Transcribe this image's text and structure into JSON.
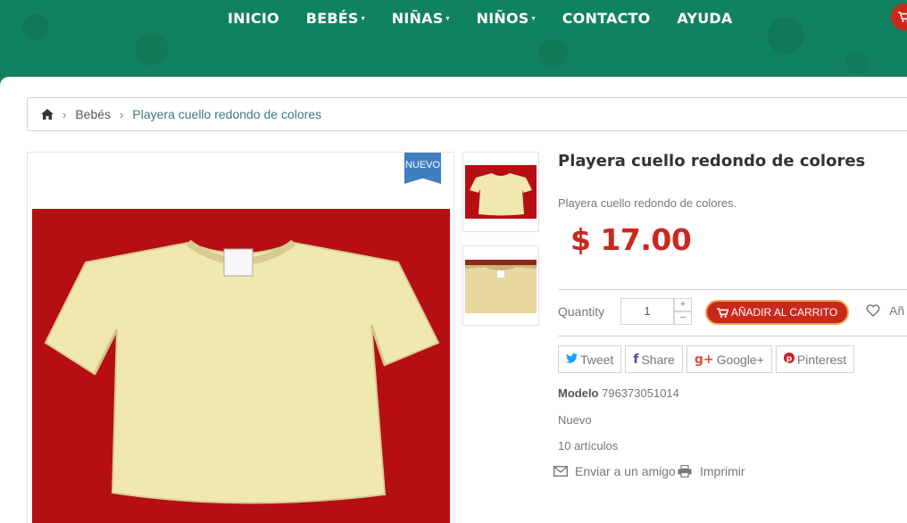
{
  "nav": {
    "items": [
      {
        "label": "INICIO",
        "has_caret": false
      },
      {
        "label": "BEBÉS",
        "has_caret": true
      },
      {
        "label": "NIÑAS",
        "has_caret": true
      },
      {
        "label": "NIÑOS",
        "has_caret": true
      },
      {
        "label": "CONTACTO",
        "has_caret": false
      },
      {
        "label": "AYUDA",
        "has_caret": false
      }
    ],
    "caret": "▾"
  },
  "breadcrumb": {
    "sep": "›",
    "category": "Bebés",
    "current": "Playera cuello redondo de colores"
  },
  "product": {
    "badge": "NUEVO",
    "title": "Playera cuello redondo de colores",
    "description": "Playera cuello redondo de colores.",
    "price": "$ 17.00",
    "quantity_label": "Quantity",
    "quantity_value": "1",
    "qty_plus": "+",
    "qty_minus": "−",
    "add_to_cart": "AÑADIR AL CARRITO",
    "wishlist_label": "Añ",
    "model_label": "Modelo",
    "model_value": "796373051014",
    "condition": "Nuevo",
    "stock": "10 artículos",
    "send_friend": "Enviar a un amigo",
    "print": "Imprimir"
  },
  "social": [
    {
      "icon": "twitter-icon",
      "glyph": "🐦",
      "label": "Tweet",
      "color": "#1da1f2"
    },
    {
      "icon": "facebook-icon",
      "glyph": "f",
      "label": "Share",
      "color": "#3b5998"
    },
    {
      "icon": "google-plus-icon",
      "glyph": "g+",
      "label": "Google+",
      "color": "#dd4b39"
    },
    {
      "icon": "pinterest-icon",
      "glyph": "P",
      "label": "Pinterest",
      "color": "#cb2027"
    }
  ],
  "colors": {
    "brand_green": "#11825f",
    "accent_red": "#c8291b",
    "ribbon_blue": "#3f7ebf"
  }
}
